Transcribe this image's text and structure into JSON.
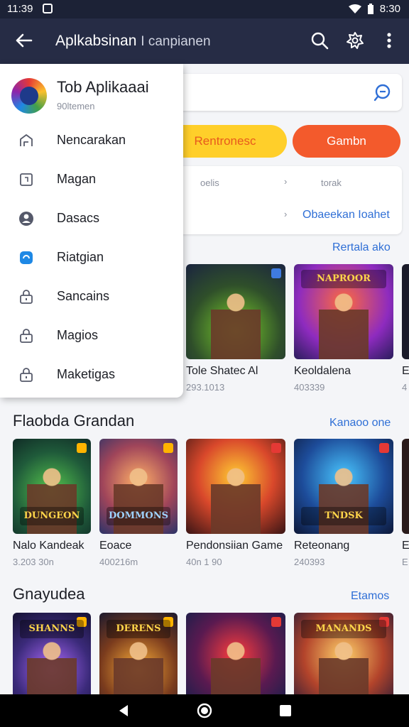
{
  "status": {
    "time": "11:39",
    "right_text": "8:30"
  },
  "appbar": {
    "title_main": "Aplkabsinan",
    "title_sub": "I canpianen"
  },
  "filters": {
    "pill_1": "Rentronesc",
    "pill_2": "Gambn"
  },
  "info_card": {
    "col1": "oelis",
    "col2": "torak",
    "link": "Obaeekan Ioahet"
  },
  "sections": [
    {
      "see_more": "Rertala ako",
      "title": "",
      "cards": [
        {
          "name": "Tole Shatec Al",
          "meta": "293.1013",
          "banner": ""
        },
        {
          "name": "Keoldalena",
          "meta": "403339",
          "banner": "NAPROOR"
        },
        {
          "name": "E",
          "meta": "4",
          "banner": ""
        }
      ]
    },
    {
      "title": "Flaobda Grandan",
      "see_more": "Kanaoo one",
      "cards": [
        {
          "name": "Nalo Kandeak",
          "meta": "3.203 30n",
          "banner": "DUNGEON"
        },
        {
          "name": "Eoace",
          "meta": "400216m",
          "banner": "DOMMONS"
        },
        {
          "name": "Pendonsiian Game",
          "meta": "40n 1 90",
          "banner": ""
        },
        {
          "name": "Reteonang",
          "meta": "240393",
          "banner": "TNDSK"
        },
        {
          "name": "E",
          "meta": "E",
          "banner": ""
        }
      ]
    },
    {
      "title": "Gnayudea",
      "see_more": "Etamos",
      "cards": [
        {
          "name": "",
          "meta": "",
          "banner": "SHANNS"
        },
        {
          "name": "",
          "meta": "",
          "banner": "DERENS"
        },
        {
          "name": "",
          "meta": "",
          "banner": ""
        },
        {
          "name": "",
          "meta": "",
          "banner": "MANANDS"
        }
      ]
    }
  ],
  "drawer": {
    "title": "Tob Aplikaaai",
    "subtitle": "90ltemen",
    "items": [
      {
        "label": "Nencarakan",
        "icon": "home-outline-icon"
      },
      {
        "label": "Magan",
        "icon": "square-icon"
      },
      {
        "label": "Dasacs",
        "icon": "user-circle-icon"
      },
      {
        "label": "Riatgian",
        "icon": "blue-app-icon"
      },
      {
        "label": "Sancains",
        "icon": "lock-icon"
      },
      {
        "label": "Magios",
        "icon": "lock-icon"
      },
      {
        "label": "Maketigas",
        "icon": "lock-icon"
      }
    ]
  },
  "colors": {
    "appbar": "#262c45",
    "accent": "#2f6fd6",
    "pill_yellow": "#ffcf2a",
    "pill_orange": "#f35a2c"
  }
}
